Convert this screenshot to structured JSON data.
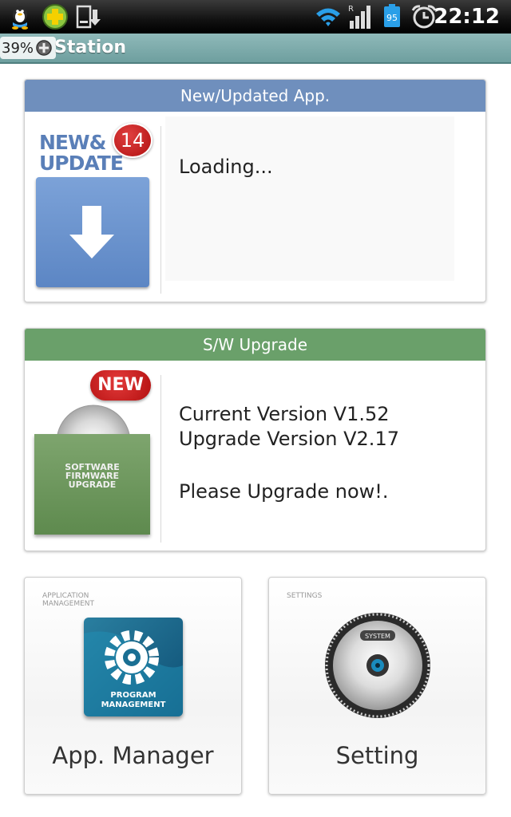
{
  "status_bar": {
    "time": "22:12",
    "battery_level_text": "95",
    "network_indicator": "R",
    "icons": [
      "qq-penguin-icon",
      "plus-app-icon",
      "download-icon",
      "wifi-icon",
      "signal-icon",
      "battery-icon",
      "alarm-icon"
    ]
  },
  "title_bar": {
    "battery_overlay": "39%",
    "title": "Station"
  },
  "new_update_card": {
    "header": "New/Updated App.",
    "badge_count": "14",
    "image_line1": "NEW&",
    "image_line2": "UPDATE",
    "status_text": "Loading...",
    "header_color": "#6e8cba"
  },
  "sw_upgrade_card": {
    "header": "S/W Upgrade",
    "new_badge": "NEW",
    "box_lines": [
      "SOFTWARE",
      "FIRMWARE",
      "UPGRADE"
    ],
    "current_version": "Current Version V1.52",
    "upgrade_version": "Upgrade Version V2.17",
    "message": "Please Upgrade now!.",
    "header_color": "#6aa06a"
  },
  "app_manager_tile": {
    "caption_line1": "APPLICATION",
    "caption_line2": "MANAGEMENT",
    "icon_line1": "PROGRAM",
    "icon_line2": "MANAGEMENT",
    "label": "App. Manager"
  },
  "setting_tile": {
    "caption": "SETTINGS",
    "disc_label": "SYSTEM",
    "label": "Setting"
  }
}
